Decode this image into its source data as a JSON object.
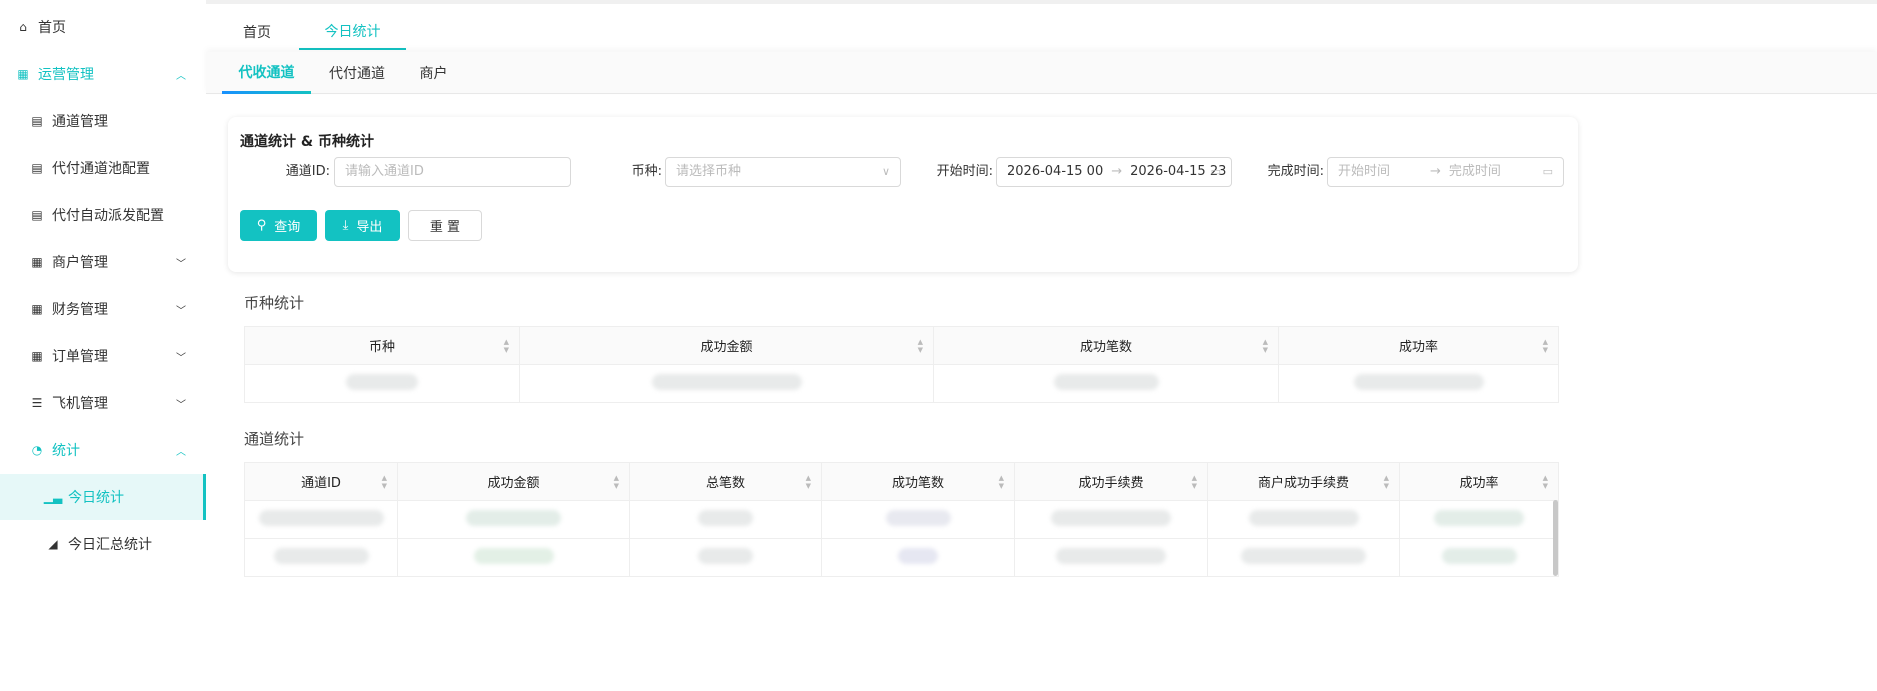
{
  "sidebar": {
    "items": [
      {
        "label": "首页",
        "icon": "home-icon"
      },
      {
        "label": "运营管理",
        "icon": "grid-icon",
        "expanded": true
      },
      {
        "label": "通道管理",
        "icon": "list-doc-icon"
      },
      {
        "label": "代付通道池配置",
        "icon": "list-doc-icon"
      },
      {
        "label": "代付自动派发配置",
        "icon": "list-doc-icon"
      },
      {
        "label": "商户管理",
        "icon": "grid-icon"
      },
      {
        "label": "财务管理",
        "icon": "grid-icon"
      },
      {
        "label": "订单管理",
        "icon": "grid-icon"
      },
      {
        "label": "飞机管理",
        "icon": "list-icon"
      },
      {
        "label": "统计",
        "icon": "pie-chart-icon",
        "expanded": true
      },
      {
        "label": "今日统计",
        "icon": "bar-chart-icon",
        "active": true
      },
      {
        "label": "今日汇总统计",
        "icon": "area-chart-icon"
      }
    ]
  },
  "top_tabs": [
    {
      "label": "首页"
    },
    {
      "label": "今日统计",
      "active": true
    }
  ],
  "sub_tabs": [
    {
      "label": "代收通道",
      "active": true
    },
    {
      "label": "代付通道"
    },
    {
      "label": "商户"
    }
  ],
  "filter": {
    "title": "通道统计 & 币种统计",
    "channel_id_label": "通道ID:",
    "channel_id_placeholder": "请输入通道ID",
    "currency_label": "币种:",
    "currency_placeholder": "请选择币种",
    "start_label": "开始时间:",
    "start_from": "2026-04-15 00",
    "start_to": "2026-04-15 23",
    "finish_label": "完成时间:",
    "finish_from_placeholder": "开始时间",
    "finish_to_placeholder": "完成时间",
    "query": "查询",
    "export": "导出",
    "reset": "重 置"
  },
  "currency_stats": {
    "title": "币种统计",
    "columns": [
      "币种",
      "成功金额",
      "成功笔数",
      "成功率"
    ]
  },
  "channel_stats": {
    "title": "通道统计",
    "columns": [
      "通道ID",
      "成功金额",
      "总笔数",
      "成功笔数",
      "成功手续费",
      "商户成功手续费",
      "成功率"
    ]
  },
  "colors": {
    "accent": "#13c2c2"
  }
}
